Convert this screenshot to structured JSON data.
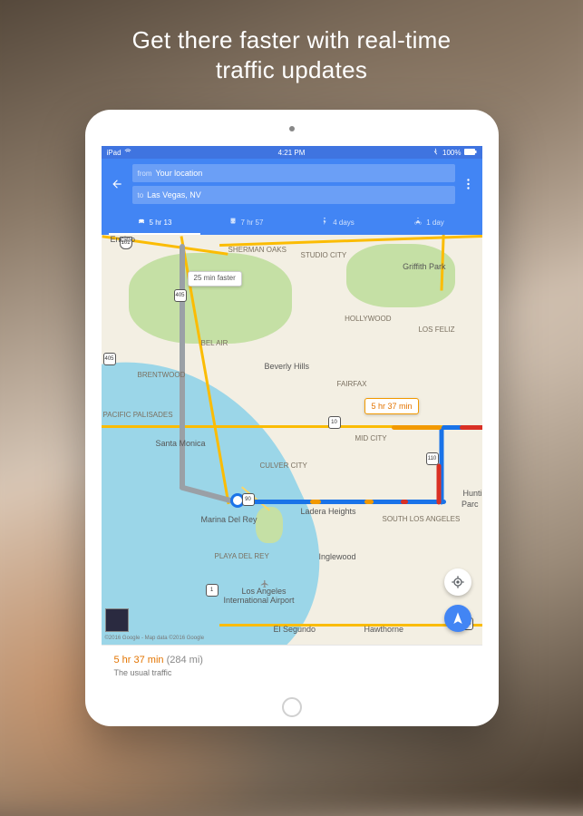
{
  "promo": {
    "headline_l1": "Get there faster with real-time",
    "headline_l2": "traffic updates"
  },
  "statusbar": {
    "left": "iPad",
    "wifi": "wifi-icon",
    "time": "4:21 PM",
    "battery_pct": "100%"
  },
  "header": {
    "from_prefix": "from",
    "from_value": "Your location",
    "to_prefix": "to",
    "to_value": "Las Vegas, NV"
  },
  "modes": [
    {
      "id": "car",
      "label": "5 hr 13",
      "active": true
    },
    {
      "id": "transit",
      "label": "7 hr 57",
      "active": false
    },
    {
      "id": "walk",
      "label": "4 days",
      "active": false
    },
    {
      "id": "bike",
      "label": "1 day",
      "active": false
    }
  ],
  "map": {
    "flag_main": "5 hr 37 min",
    "flag_alt": "25 min faster",
    "labels": {
      "encino": "Encino",
      "griffith": "Griffith Park",
      "hollywood": "HOLLYWOOD",
      "bev": "Beverly Hills",
      "losfeliz": "LOS FELIZ",
      "belair": "BEL AIR",
      "brentwood": "BRENTWOOD",
      "palisades": "PACIFIC PALISADES",
      "sm": "Santa Monica",
      "culver": "CULVER CITY",
      "ladera": "Ladera Heights",
      "mdr": "Marina Del Rey",
      "inglewood": "Inglewood",
      "lax1": "Los Angeles",
      "lax2": "International Airport",
      "elsegundo": "El Segundo",
      "hawthorne": "Hawthorne",
      "southla": "SOUTH LOS ANGELES",
      "hunti": "Hunti",
      "parc": "Parc",
      "studiocity": "STUDIO CITY",
      "shermanoaks": "SHERMAN OAKS",
      "playa": "PLAYA DEL REY",
      "brylawn": "FAIRFAX",
      "culvermid": "MID CITY"
    },
    "shields": {
      "405a": "405",
      "405b": "405",
      "101": "101",
      "10": "10",
      "110": "110",
      "90": "90",
      "105": "105",
      "1": "1"
    },
    "attribution": "©2016 Google - Map data ©2016 Google"
  },
  "card": {
    "duration": "5 hr 37 min",
    "distance": "(284 mi)",
    "subtitle": "The usual traffic"
  }
}
